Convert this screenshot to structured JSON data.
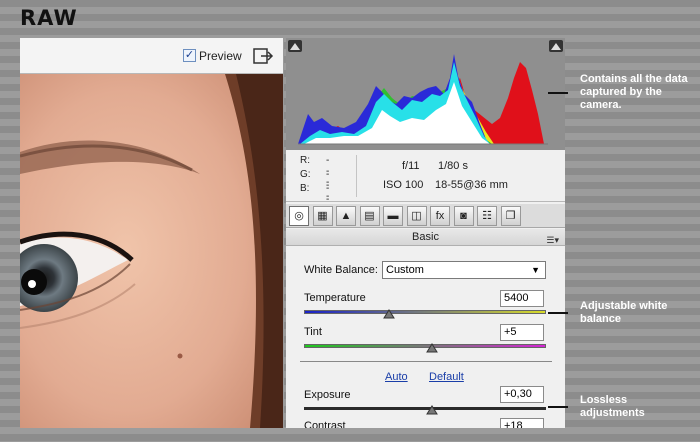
{
  "page": {
    "title": "RAW"
  },
  "image_panel": {
    "preview_checked": true,
    "preview_label": "Preview"
  },
  "histogram": {
    "rgb": [
      {
        "label": "R:",
        "value": "---"
      },
      {
        "label": "G:",
        "value": "---"
      },
      {
        "label": "B:",
        "value": "---"
      }
    ],
    "aperture": "f/11",
    "shutter": "1/80 s",
    "iso": "ISO 100",
    "lens": "18-55@36 mm"
  },
  "tabs": [
    {
      "name": "basic",
      "glyph": "◎"
    },
    {
      "name": "tone-curve",
      "glyph": "▦"
    },
    {
      "name": "detail",
      "glyph": "▲"
    },
    {
      "name": "hsl",
      "glyph": "▤"
    },
    {
      "name": "split-toning",
      "glyph": "▬"
    },
    {
      "name": "lens-corrections",
      "glyph": "◫"
    },
    {
      "name": "effects",
      "glyph": "fx"
    },
    {
      "name": "camera-calibration",
      "glyph": "◙"
    },
    {
      "name": "presets",
      "glyph": "☷"
    },
    {
      "name": "snapshots",
      "glyph": "❐"
    }
  ],
  "basic": {
    "section_title": "Basic",
    "white_balance_label": "White Balance:",
    "white_balance_value": "Custom",
    "temperature_label": "Temperature",
    "temperature_value": "5400",
    "temperature_level": 0.35,
    "tint_label": "Tint",
    "tint_value": "+5",
    "tint_level": 0.53,
    "auto_label": "Auto",
    "default_label": "Default",
    "exposure_label": "Exposure",
    "exposure_value": "+0,30",
    "exposure_level": 0.53,
    "contrast_label": "Contrast",
    "contrast_value": "+18"
  },
  "callouts": [
    "Contains all the data captured by the camera.",
    "Adjustable white balance",
    "Lossless adjustments"
  ],
  "colors": {
    "temperature_start": "#1a22c8",
    "temperature_end": "#d8dc2a",
    "tint_start": "#1ec81e",
    "tint_end": "#d424d4",
    "link": "#1a3ea8"
  }
}
